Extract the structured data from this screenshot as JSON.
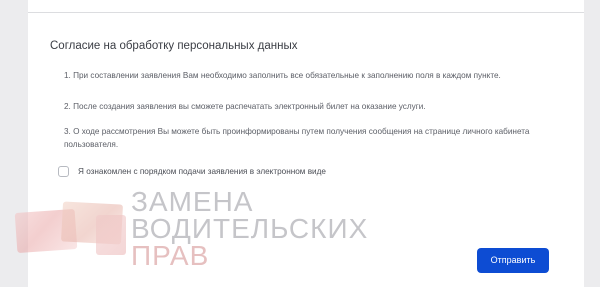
{
  "consent": {
    "title": "Согласие на обработку персональных данных",
    "items": [
      "1. При составлении заявления Вам необходимо заполнить все обязательные к заполнению поля в каждом пункте.",
      "2. После создания заявления вы сможете распечатать электронный билет на оказание услуги.",
      "3. О ходе рассмотрения Вы можете быть проинформированы путем получения сообщения на странице личного кабинета пользователя."
    ],
    "agree_label": "Я ознакомлен с порядком подачи заявления в электронном виде",
    "agree_checked": false
  },
  "actions": {
    "submit_label": "Отправить"
  },
  "watermark": {
    "line1": "ЗАМЕНА",
    "line2": "ВОДИТЕЛЬСКИХ",
    "line3": "ПРАВ"
  },
  "colors": {
    "accent": "#0d4cd3",
    "background": "#ececee",
    "panel": "#ffffff"
  }
}
